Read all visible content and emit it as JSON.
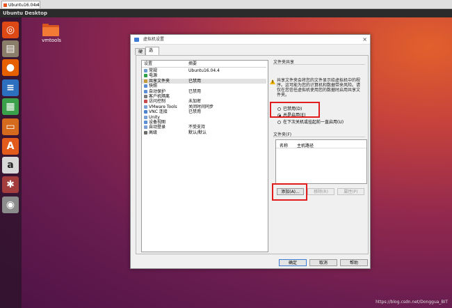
{
  "browser_tab": {
    "title": "Ubuntu16.04.4",
    "close": "×"
  },
  "topbar": {
    "title": "Ubuntu Desktop"
  },
  "launcher": [
    {
      "name": "ubuntu-dash-icon",
      "glyph": "◎",
      "bg": "#dd4814"
    },
    {
      "name": "files-icon",
      "glyph": "▤",
      "bg": "#8a7d6a"
    },
    {
      "name": "firefox-icon",
      "glyph": "●",
      "bg": "#e66000"
    },
    {
      "name": "writer-icon",
      "glyph": "≡",
      "bg": "#2d6fbf"
    },
    {
      "name": "calc-icon",
      "glyph": "▦",
      "bg": "#3aa04a"
    },
    {
      "name": "impress-icon",
      "glyph": "▭",
      "bg": "#d46a1e"
    },
    {
      "name": "software-center-icon",
      "glyph": "A",
      "bg": "#e35b1c"
    },
    {
      "name": "amazon-icon",
      "glyph": "a",
      "bg": "#d8d8d8"
    },
    {
      "name": "system-settings-icon",
      "glyph": "✱",
      "bg": "#a33c3c"
    },
    {
      "name": "dvd-icon",
      "glyph": "◉",
      "bg": "#8c8c8c"
    }
  ],
  "desktop_icon": {
    "label": "vmtools"
  },
  "dialog": {
    "title": "虚拟机设置",
    "close": "×",
    "tabs": [
      "硬件",
      "选项"
    ],
    "list_headers": {
      "setting": "设置",
      "summary": "摘要"
    },
    "settings": [
      {
        "name": "常规",
        "value": "Ubuntu16.04.4",
        "color": "#6b9bd1"
      },
      {
        "name": "电源",
        "value": "",
        "color": "#2ea043"
      },
      {
        "name": "共享文件夹",
        "value": "已禁用",
        "color": "#c49a3a",
        "selected": true
      },
      {
        "name": "快照",
        "value": "",
        "color": "#5a8fd6"
      },
      {
        "name": "自动保护",
        "value": "已禁用",
        "color": "#5a8fd6"
      },
      {
        "name": "客户机隔离",
        "value": "",
        "color": "#7a7a7a"
      },
      {
        "name": "访问控制",
        "value": "未加密",
        "color": "#c94a4a"
      },
      {
        "name": "VMware Tools",
        "value": "关闭时间同步",
        "color": "#7aa0d8"
      },
      {
        "name": "VNC 连接",
        "value": "已禁用",
        "color": "#4a84cf"
      },
      {
        "name": "Unity",
        "value": "",
        "color": "#7aa0d8"
      },
      {
        "name": "设备视图",
        "value": "",
        "color": "#5a8fd6"
      },
      {
        "name": "自动登录",
        "value": "不受支持",
        "color": "#7aa0d8"
      },
      {
        "name": "高级",
        "value": "默认/默认",
        "color": "#6a6a6a"
      }
    ],
    "share_group_title": "文件夹共享",
    "share_warning": "共享文件夹会将您的文件显示给虚拟机中的程序。这可能为您的计算机和数据带来风险。请仅在您信任虚拟机使用您的数据时启用共享文件夹。",
    "share_options": [
      {
        "label": "已禁用(D)",
        "checked": false,
        "disabled": false
      },
      {
        "label": "总是启用(E)",
        "checked": true,
        "disabled": false
      },
      {
        "label": "在下次关机或挂起前一直启用(U)",
        "checked": false,
        "disabled": false
      }
    ],
    "folders_group_title": "文件夹(F)",
    "folders_headers": {
      "name": "名称",
      "host_path": "主机路径"
    },
    "buttons": {
      "add": "添加(A)...",
      "remove": "移除(R)",
      "properties": "属性(P)"
    },
    "footer": {
      "ok": "确定",
      "cancel": "取消",
      "help": "帮助"
    }
  },
  "watermark": "https://blog.csdn.net/Donggua_BIT",
  "colors": {
    "highlight": "#e21c1c",
    "accent": "#e95420"
  }
}
